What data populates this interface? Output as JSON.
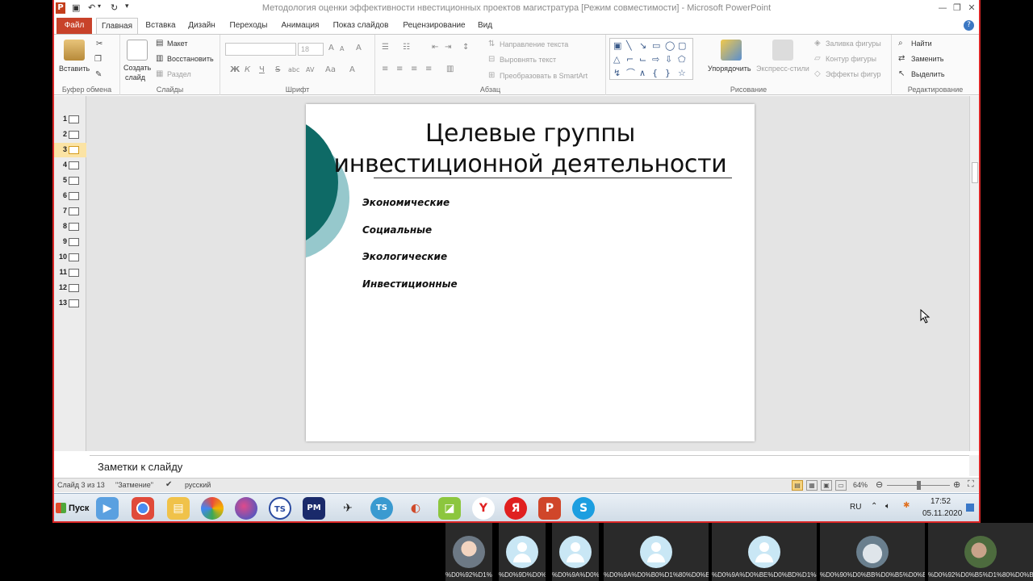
{
  "app": {
    "title": "Методология оценки эффективности нвестиционных проектов магистратура [Режим совместимости]  -  Microsoft PowerPoint",
    "logo_letter": "P",
    "accent": "#c8422a"
  },
  "window_buttons": {
    "minimize": "—",
    "restore": "❐",
    "close": "✕"
  },
  "help_icon": "?",
  "tabs": [
    {
      "label": "Файл"
    },
    {
      "label": "Главная"
    },
    {
      "label": "Вставка"
    },
    {
      "label": "Дизайн"
    },
    {
      "label": "Переходы"
    },
    {
      "label": "Анимация"
    },
    {
      "label": "Показ слайдов"
    },
    {
      "label": "Рецензирование"
    },
    {
      "label": "Вид"
    }
  ],
  "ribbon": {
    "clipboard": {
      "label": "Буфер обмена",
      "paste": "Вставить"
    },
    "slides": {
      "label": "Слайды",
      "create1": "Создать",
      "create2": "слайд",
      "layout": "Макет",
      "reset": "Восстановить",
      "section": "Раздел"
    },
    "font": {
      "label": "Шрифт",
      "size": "18",
      "bold": "Ж",
      "italic": "К",
      "underline": "Ч",
      "strike": "S",
      "shadow": "abc",
      "spacing": "AV",
      "case": "Aa",
      "grow": "A",
      "shrink": "A",
      "clear": "A",
      "color": "A"
    },
    "paragraph": {
      "label": "Абзац",
      "direction": "Направление текста",
      "align": "Выровнять текст",
      "smartart": "Преобразовать в SmartArt"
    },
    "drawing": {
      "label": "Рисование",
      "arrange": "Упорядочить",
      "styles": "Экспресс-стили",
      "fill": "Заливка фигуры",
      "outline": "Контур фигуры",
      "effects": "Эффекты фигур"
    },
    "editing": {
      "label": "Редактирование",
      "find": "Найти",
      "replace": "Заменить",
      "select": "Выделить"
    }
  },
  "thumbnails": [
    "1",
    "2",
    "3",
    "4",
    "5",
    "6",
    "7",
    "8",
    "9",
    "10",
    "11",
    "12",
    "13"
  ],
  "active_thumbnail": 3,
  "slide": {
    "title_line1": "Целевые группы",
    "title_line2": "инвестиционной деятельности",
    "bullets": [
      "Экономические",
      "Социальные",
      "Экологические",
      "Инвестиционные"
    ]
  },
  "notes": {
    "placeholder": "Заметки к слайду"
  },
  "status": {
    "slide_info": "Слайд 3 из 13",
    "theme": "\"Затмение\"",
    "language": "русский",
    "zoom": "64%",
    "zoom_level": 0.5
  },
  "taskbar": {
    "start": "Пуск",
    "lang": "RU",
    "time": "17:52",
    "date": "05.11.2020",
    "apps": [
      "video-player",
      "chrome",
      "file-manager",
      "photo-viewer",
      "paint",
      "ts-app",
      "pm-app",
      "bird-app",
      "ts-client",
      "parrot-app",
      "drawing-app",
      "yandex-browser",
      "yandex",
      "powerpoint",
      "skype"
    ]
  },
  "participants": [
    {
      "label": "%D0%92%D1%...",
      "avatar": "photo1"
    },
    {
      "label": "%D0%9D%D0%...",
      "avatar": "person"
    },
    {
      "label": "%D0%9A%D0%...",
      "avatar": "person"
    },
    {
      "label": "%D0%9A%D0%B0%D1%80%D0%BF...",
      "avatar": "person"
    },
    {
      "label": "%D0%9A%D0%BE%D0%BD%D1%8...",
      "avatar": "person"
    },
    {
      "label": "%D0%90%D0%BB%D0%B5%D0%B...",
      "avatar": "photo2"
    },
    {
      "label": "%D0%92%D0%B5%D1%80%D0%B0...",
      "avatar": "photo3"
    }
  ]
}
